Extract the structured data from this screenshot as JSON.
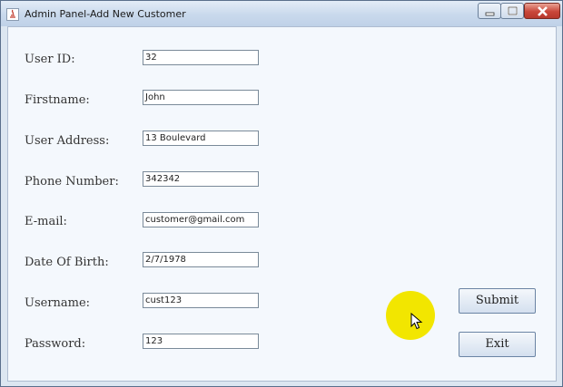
{
  "window": {
    "title": "Admin Panel-Add New Customer"
  },
  "form": {
    "fields": [
      {
        "label": "User ID:",
        "value": "32"
      },
      {
        "label": "Firstname:",
        "value": "John"
      },
      {
        "label": "User Address:",
        "value": "13 Boulevard"
      },
      {
        "label": "Phone Number:",
        "value": "342342"
      },
      {
        "label": "E-mail:",
        "value": "customer@gmail.com"
      },
      {
        "label": "Date Of Birth:",
        "value": "2/7/1978"
      },
      {
        "label": "Username:",
        "value": "cust123"
      },
      {
        "label": "Password:",
        "value": "123"
      }
    ],
    "submit_label": "Submit",
    "exit_label": "Exit"
  },
  "colors": {
    "accent": "#f2e600",
    "close": "#c9473a",
    "background": "#f4f8fd"
  },
  "icons": [
    "java-app-icon",
    "minimize-icon",
    "maximize-icon",
    "close-icon",
    "cursor-icon"
  ]
}
